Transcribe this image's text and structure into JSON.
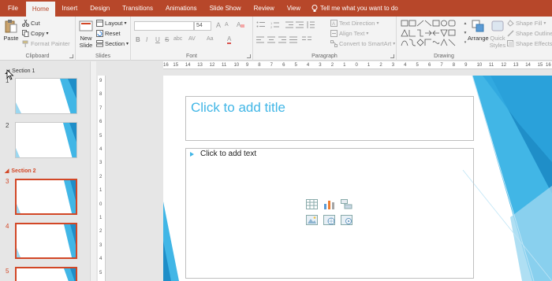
{
  "tabs": [
    {
      "label": "File",
      "active": false
    },
    {
      "label": "Home",
      "active": true
    },
    {
      "label": "Insert",
      "active": false
    },
    {
      "label": "Design",
      "active": false
    },
    {
      "label": "Transitions",
      "active": false
    },
    {
      "label": "Animations",
      "active": false
    },
    {
      "label": "Slide Show",
      "active": false
    },
    {
      "label": "Review",
      "active": false
    },
    {
      "label": "View",
      "active": false
    }
  ],
  "tell_me": {
    "label": "Tell me what you want to do",
    "icon": "lightbulb-icon"
  },
  "clipboard": {
    "label": "Clipboard",
    "paste": "Paste",
    "cut": "Cut",
    "copy": "Copy",
    "format_painter": "Format Painter"
  },
  "slides_group": {
    "label": "Slides",
    "new_slide": "New\nSlide",
    "layout": "Layout",
    "reset": "Reset",
    "section": "Section"
  },
  "font_group": {
    "label": "Font",
    "font_name": "",
    "font_size": "54",
    "bold": "B",
    "italic": "I",
    "underline": "U",
    "strike": "S",
    "shadow": "abc",
    "grow": "A",
    "shrink": "A",
    "spacing": "AV",
    "case": "Aa",
    "color": "A"
  },
  "paragraph_group": {
    "label": "Paragraph",
    "text_direction": "Text Direction",
    "align_text": "Align Text",
    "convert_smartart": "Convert to SmartArt"
  },
  "drawing_group": {
    "label": "Drawing",
    "arrange": "Arrange",
    "quick_styles": "Quick\nStyles",
    "shape_fill": "Shape Fill",
    "shape_outline": "Shape Outline",
    "shape_effects": "Shape Effects"
  },
  "sections": [
    {
      "name": "Section 1",
      "color": "#444444"
    },
    {
      "name": "Section 2",
      "color": "#d24726"
    }
  ],
  "slide_numbers": [
    "1",
    "2",
    "3",
    "4",
    "5"
  ],
  "thumb1_title": "",
  "slide": {
    "title_placeholder": "Click to add title",
    "body_placeholder": "Click to add text"
  },
  "ruler_h": [
    "16",
    "15",
    "14",
    "13",
    "12",
    "11",
    "10",
    "9",
    "8",
    "7",
    "6",
    "5",
    "4",
    "3",
    "2",
    "1",
    "0",
    "1",
    "2",
    "3",
    "4",
    "5",
    "6",
    "7",
    "8",
    "9",
    "10",
    "11",
    "12",
    "13",
    "14",
    "15",
    "16"
  ],
  "ruler_v": [
    "9",
    "8",
    "7",
    "6",
    "5",
    "4",
    "3",
    "2",
    "1",
    "0",
    "1",
    "2",
    "3",
    "4",
    "5"
  ],
  "colors": {
    "accent": "#b7472a",
    "title_blue": "#41b6e6",
    "selected_border": "#d24726"
  }
}
